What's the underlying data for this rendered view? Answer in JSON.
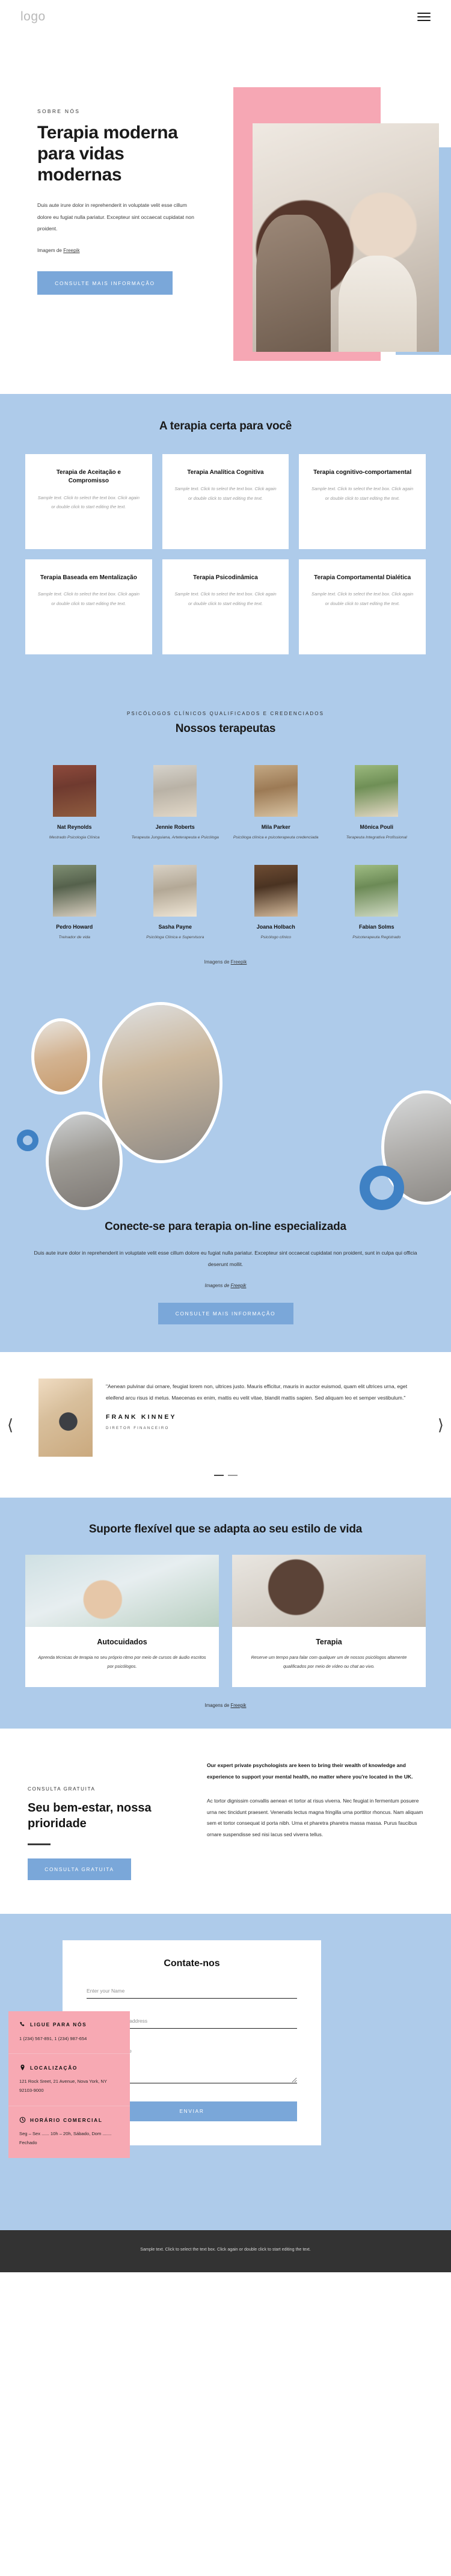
{
  "header": {
    "logo": "logo",
    "menu_icon": "hamburger-menu"
  },
  "hero": {
    "eyebrow": "SOBRE NÓS",
    "title": "Terapia moderna para vidas modernas",
    "copy": "Duis aute irure dolor in reprehenderit in voluptate velit esse cillum dolore eu fugiat nulla pariatur. Excepteur sint occaecat cupidatat non proident.",
    "credit_prefix": "Imagem de ",
    "credit_link": "Freepik",
    "cta": "CONSULTE MAIS INFORMAÇÃO"
  },
  "therapy": {
    "title": "A terapia certa para você",
    "sample": "Sample text. Click to select the text box. Click again or double click to start editing the text.",
    "cards": [
      {
        "title": "Terapia de Aceitação e Compromisso"
      },
      {
        "title": "Terapia Analítica Cognitiva"
      },
      {
        "title": "Terapia cognitivo-comportamental"
      },
      {
        "title": "Terapia Baseada em Mentalização"
      },
      {
        "title": "Terapia Psicodinâmica"
      },
      {
        "title": "Terapia Comportamental Dialética"
      }
    ]
  },
  "team": {
    "eyebrow": "PSICÓLOGOS CLÍNICOS QUALIFICADOS E CREDENCIADOS",
    "title": "Nossos terapeutas",
    "credit_prefix": "Imagens de ",
    "credit_link": "Freepik",
    "members": [
      {
        "name": "Nat Reynolds",
        "role": "Mestrado Psicologia Clínica"
      },
      {
        "name": "Jennie Roberts",
        "role": "Terapeuta Junguiana, Arteterapeuta e Psicóloga"
      },
      {
        "name": "Mila Parker",
        "role": "Psicóloga clínica e psicoterapeuta credenciada"
      },
      {
        "name": "Mônica Pouli",
        "role": "Terapeuta Integrativa Profissional"
      },
      {
        "name": "Pedro Howard",
        "role": "Treinador de vida"
      },
      {
        "name": "Sasha Payne",
        "role": "Psicóloga Clínica e Supervisora"
      },
      {
        "name": "Joana Holbach",
        "role": "Psicólogo clínico"
      },
      {
        "name": "Fabian Solms",
        "role": "Psicoterapeuta Registrado"
      }
    ]
  },
  "online": {
    "title": "Conecte-se para terapia on-line especializada",
    "copy": "Duis aute irure dolor in reprehenderit in voluptate velit esse cillum dolore eu fugiat nulla pariatur. Excepteur sint occaecat cupidatat non proident, sunt in culpa qui officia deserunt mollit.",
    "credit_prefix": "Imagens de ",
    "credit_link": "Freepik",
    "cta": "CONSULTE MAIS INFORMAÇÃO"
  },
  "testimonial": {
    "quote": "\"Aenean pulvinar dui ornare, feugiat lorem non, ultrices justo. Mauris efficitur, mauris in auctor euismod, quam elit ultrices urna, eget eleifend arcu risus id metus. Maecenas ex enim, mattis eu velit vitae, blandit mattis sapien. Sed aliquam leo et semper vestibulum.\"",
    "name": "FRANK KINNEY",
    "role": "DIRETOR FINANCEIRO",
    "prev_icon": "chevron-left-icon",
    "next_icon": "chevron-right-icon"
  },
  "flexible": {
    "title": "Suporte flexível que se adapta ao seu estilo de vida",
    "credit_prefix": "Imagens de ",
    "credit_link": "Freepik",
    "cards": [
      {
        "title": "Autocuidados",
        "text": "Aprenda técnicas de terapia no seu próprio ritmo por meio de cursos de áudio escritos por psicólogos."
      },
      {
        "title": "Terapia",
        "text": "Reserve um tempo para falar com qualquer um de nossos psicólogos altamente qualificados por meio de vídeo ou chat ao vivo."
      }
    ]
  },
  "wellbeing": {
    "eyebrow": "CONSULTA GRATUITA",
    "title": "Seu bem-estar, nossa prioridade",
    "cta": "CONSULTA GRATUITA",
    "lead": "Our expert private psychologists are keen to bring their wealth of knowledge and experience to support your mental health, no matter where you're located in the UK.",
    "body": "Ac tortor dignissim convallis aenean et tortor at risus viverra. Nec feugiat in fermentum posuere urna nec tincidunt praesent. Venenatis lectus magna fringilla urna porttitor rhoncus. Nam aliquam sem et tortor consequat id porta nibh. Urna et pharetra pharetra massa massa. Purus faucibus ornare suspendisse sed nisi lacus sed viverra tellus."
  },
  "contact": {
    "title": "Contate-nos",
    "name_placeholder": "Enter your Name",
    "email_placeholder": "Enter a valid email address",
    "message_placeholder": "Enter your message",
    "submit": "ENVIAR",
    "info": [
      {
        "icon": "phone-icon",
        "heading": "LIGUE PARA NÓS",
        "text": "1 (234) 567-891, 1 (234) 987-654"
      },
      {
        "icon": "location-icon",
        "heading": "LOCALIZAÇÃO",
        "text": "121 Rock Sreet, 21 Avenue, Nova York, NY 92103-9000"
      },
      {
        "icon": "clock-icon",
        "heading": "HORÁRIO COMERCIAL",
        "text": "Seg – Sex ...... 10h – 20h, Sábado, Dom ....... Fechado"
      }
    ]
  },
  "footer": {
    "text": "Sample text. Click to select the text box. Click again or double click to start editing the text."
  },
  "colors": {
    "blue": "#aecbea",
    "accent_blue": "#7aa7d9",
    "pink": "#f7a9b3",
    "ring_blue": "#3f81c4",
    "footer_dark": "#333333"
  }
}
